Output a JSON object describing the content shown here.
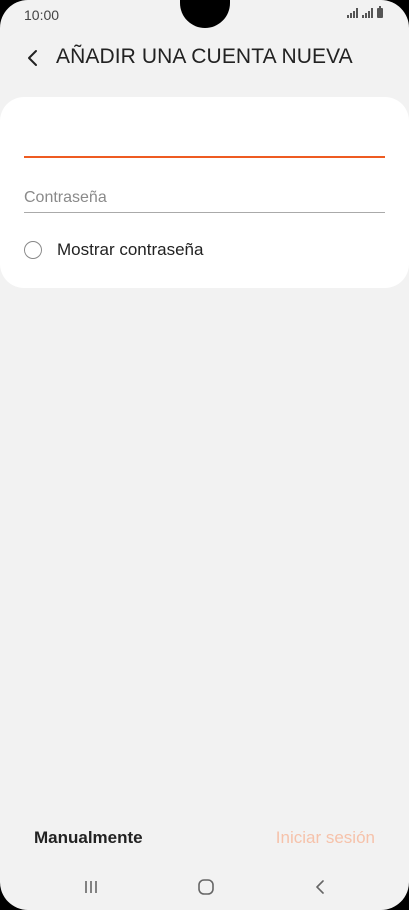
{
  "status_bar": {
    "time": "10:00"
  },
  "header": {
    "title": "AÑADIR UNA CUENTA NUEVA",
    "back_icon": "chevron-left-icon"
  },
  "form": {
    "email_value": "",
    "password_placeholder": "Contraseña",
    "show_password_label": "Mostrar contraseña",
    "show_password_checked": false
  },
  "actions": {
    "manual_label": "Manualmente",
    "login_label": "Iniciar sesión"
  },
  "nav_bar": {
    "icons": [
      "recents-icon",
      "home-icon",
      "back-icon"
    ]
  },
  "colors": {
    "accent": "#ee5b21",
    "disabled_accent": "#f6c2aa",
    "background": "#f2f2f2"
  }
}
